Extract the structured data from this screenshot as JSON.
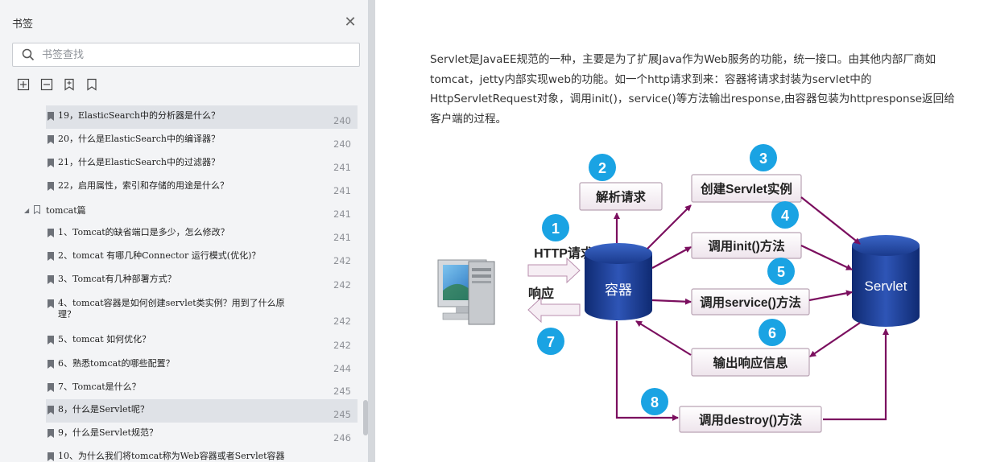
{
  "sidebar": {
    "title": "书签",
    "search_placeholder": "书签查找",
    "tools": [
      "expand-all-icon",
      "collapse-all-icon",
      "add-bookmark-icon",
      "bookmark-icon"
    ],
    "items": [
      {
        "text": "19，ElasticSearch中的分析器是什么？",
        "page": "240",
        "selected": true
      },
      {
        "text": "20，什么是ElasticSearch中的编译器？",
        "page": "240"
      },
      {
        "text": "21，什么是ElasticSearch中的过滤器？",
        "page": "241"
      },
      {
        "text": "22，启用属性，索引和存储的用途是什么？",
        "page": "241"
      },
      {
        "text": "tomcat篇",
        "page": "241",
        "group": true
      },
      {
        "text": "1、Tomcat的缺省端口是多少，怎么修改？",
        "page": "241"
      },
      {
        "text": "2、tomcat 有哪几种Connector 运行模式(优化)？",
        "page": "242"
      },
      {
        "text": "3、Tomcat有几种部署方式？",
        "page": "242"
      },
      {
        "text": "4、tomcat容器是如何创建servlet类实例？用到了什么原理？",
        "page": "242"
      },
      {
        "text": "5、tomcat 如何优化？",
        "page": "242"
      },
      {
        "text": "6、熟悉tomcat的哪些配置？",
        "page": "244"
      },
      {
        "text": "7、Tomcat是什么？",
        "page": "245"
      },
      {
        "text": "8，什么是Servlet呢？",
        "page": "245",
        "selected": true
      },
      {
        "text": "9，什么是Servlet规范？",
        "page": "246"
      },
      {
        "text": "10、为什么我们将tomcat称为Web容器或者Servlet容器",
        "page": ""
      }
    ]
  },
  "document": {
    "paragraph": "Servlet是JavaEE规范的一种，主要是为了扩展Java作为Web服务的功能，统一接口。由其他内部厂商如tomcat，jetty内部实现web的功能。如一个http请求到来：容器将请求封装为servlet中的HttpServletRequest对象，调用init()，service()等方法输出response,由容器包装为httpresponse返回给客户端的过程。",
    "diagram": {
      "http_request": "HTTP请求",
      "response": "响应",
      "container": "容器",
      "servlet": "Servlet",
      "parse_request": "解析请求",
      "create_instance": "创建Servlet实例",
      "call_init": "调用init()方法",
      "call_service": "调用service()方法",
      "output_response": "输出响应信息",
      "call_destroy": "调用destroy()方法",
      "steps": [
        "1",
        "2",
        "3",
        "4",
        "5",
        "6",
        "7",
        "8"
      ],
      "colors": {
        "step_circle": "#1aa3e3",
        "arrow": "#7b0f5f",
        "box_fill": "#f8f0f6",
        "cylinder": "#1d3d8f"
      }
    }
  }
}
